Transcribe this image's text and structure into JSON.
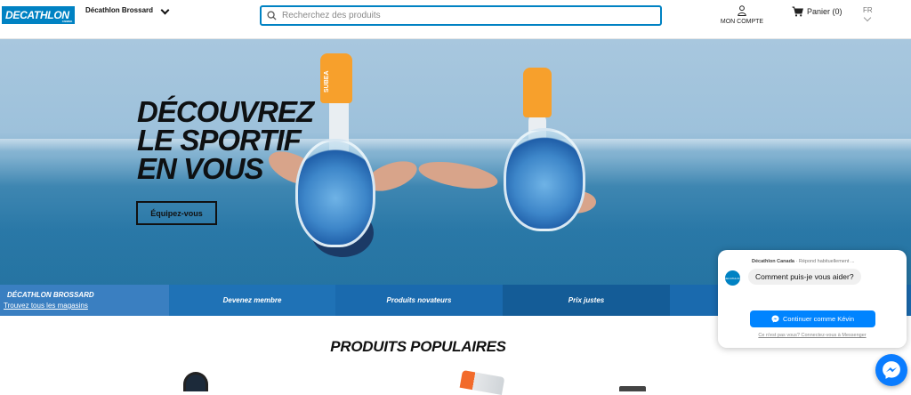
{
  "header": {
    "logo_text": "DECATHLON",
    "logo_subtext": "CANADA",
    "store_name": "Décathlon Brossard",
    "search_placeholder": "Recherchez des produits",
    "account_label": "MON COMPTE",
    "cart_label": "Panier (0)",
    "language": "FR"
  },
  "hero": {
    "title_lines": [
      "DÉCOUVREZ",
      "LE SPORTIF",
      "EN VOUS"
    ],
    "cta_label": "Équipez-vous",
    "snorkel_brand": "SUBEA"
  },
  "strip": {
    "store_title": "DÉCATHLON BROSSARD",
    "store_link": "Trouvez tous les magasins",
    "items": [
      "Devenez membre",
      "Produits novateurs",
      "Prix justes",
      ""
    ]
  },
  "popular_title": "PRODUITS POPULAIRES",
  "chat": {
    "page_name": "Décathlon Canada",
    "response_note": "· Répond habituellement ...",
    "avatar_text": "DECATHLON",
    "message": "Comment puis-je vous aider?",
    "continue_label": "Continuer comme Kévin",
    "not_you": "Ce n'est pas vous? Connectez-vous à Messenger"
  },
  "colors": {
    "brand": "#0082c3",
    "strip": [
      "#3a7fc1",
      "#1f72b6",
      "#1a6aae",
      "#145c97",
      "#1a6aae"
    ],
    "messenger": "#0084ff"
  }
}
